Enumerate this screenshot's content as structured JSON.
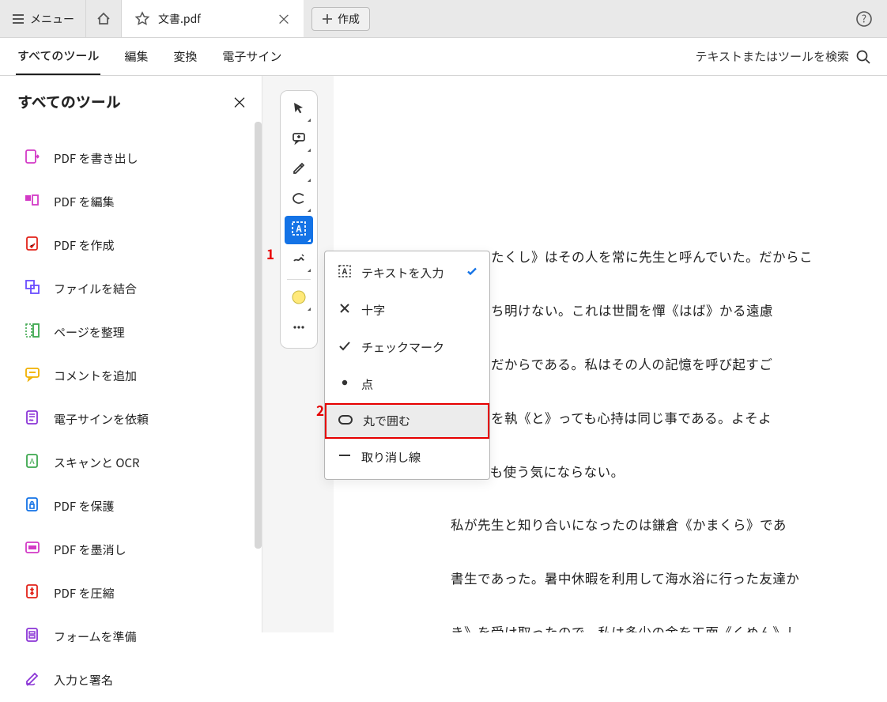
{
  "titlebar": {
    "menu_label": "メニュー",
    "tab": {
      "title": "文書.pdf"
    },
    "new_tab_label": "作成"
  },
  "toolbar": {
    "tabs": [
      {
        "label": "すべてのツール",
        "active": true
      },
      {
        "label": "編集"
      },
      {
        "label": "変換"
      },
      {
        "label": "電子サイン"
      }
    ],
    "search_placeholder": "テキストまたはツールを検索"
  },
  "sidebar": {
    "title": "すべてのツール",
    "items": [
      {
        "label": "PDF を書き出し",
        "icon": "export",
        "color": "#d33ac6"
      },
      {
        "label": "PDF を編集",
        "icon": "edit",
        "color": "#d33ac6"
      },
      {
        "label": "PDF を作成",
        "icon": "create",
        "color": "#e2231a"
      },
      {
        "label": "ファイルを結合",
        "icon": "combine",
        "color": "#6a4cff"
      },
      {
        "label": "ページを整理",
        "icon": "organize",
        "color": "#3da74e"
      },
      {
        "label": "コメントを追加",
        "icon": "comment",
        "color": "#f0b000"
      },
      {
        "label": "電子サインを依頼",
        "icon": "esign",
        "color": "#8b35d6"
      },
      {
        "label": "スキャンと OCR",
        "icon": "scan",
        "color": "#3da74e"
      },
      {
        "label": "PDF を保護",
        "icon": "protect",
        "color": "#1473e6"
      },
      {
        "label": "PDF を墨消し",
        "icon": "redact",
        "color": "#d33ac6"
      },
      {
        "label": "PDF を圧縮",
        "icon": "compress",
        "color": "#e2231a"
      },
      {
        "label": "フォームを準備",
        "icon": "form",
        "color": "#8b35d6"
      },
      {
        "label": "入力と署名",
        "icon": "fillsign",
        "color": "#8b35d6"
      }
    ]
  },
  "quickbar": {
    "buttons": [
      {
        "name": "select-tool",
        "drop": true
      },
      {
        "name": "comment-tool",
        "drop": true
      },
      {
        "name": "highlight-tool",
        "drop": true
      },
      {
        "name": "eraser-tool",
        "drop": true
      },
      {
        "name": "textbox-tool",
        "drop": true,
        "selected": true
      },
      {
        "name": "sign-tool",
        "drop": true
      },
      {
        "name": "sep"
      },
      {
        "name": "color-swatch",
        "drop": true,
        "yellow": true
      },
      {
        "name": "more-tools",
        "drop": false
      }
    ]
  },
  "popup": {
    "items": [
      {
        "label": "テキストを入力",
        "icon": "text",
        "checked": true
      },
      {
        "label": "十字",
        "icon": "cross"
      },
      {
        "label": "チェックマーク",
        "icon": "check"
      },
      {
        "label": "点",
        "icon": "dot"
      },
      {
        "label": "丸で囲む",
        "icon": "circle",
        "highlight": true
      },
      {
        "label": "取り消し線",
        "icon": "strike"
      }
    ]
  },
  "annotations": {
    "one": "1",
    "two": "2"
  },
  "document": {
    "paragraphs": [
      "私《わたくし》はその人を常に先生と呼んでいた。だからこ",
      "名は打ち明けない。これは世間を憚《はば》かる遠慮",
      "て自然だからである。私はその人の記憶を呼び起すご",
      "る。筆を執《と》っても心持は同じ事である。よそよ",
      "はとても使う気にならない。",
      "私が先生と知り合いになったのは鎌倉《かまくら》であ",
      "書生であった。暑中休暇を利用して海水浴に行った友達か",
      "き》を受け取ったので、私は多少の金を工面《くめん》し"
    ]
  }
}
